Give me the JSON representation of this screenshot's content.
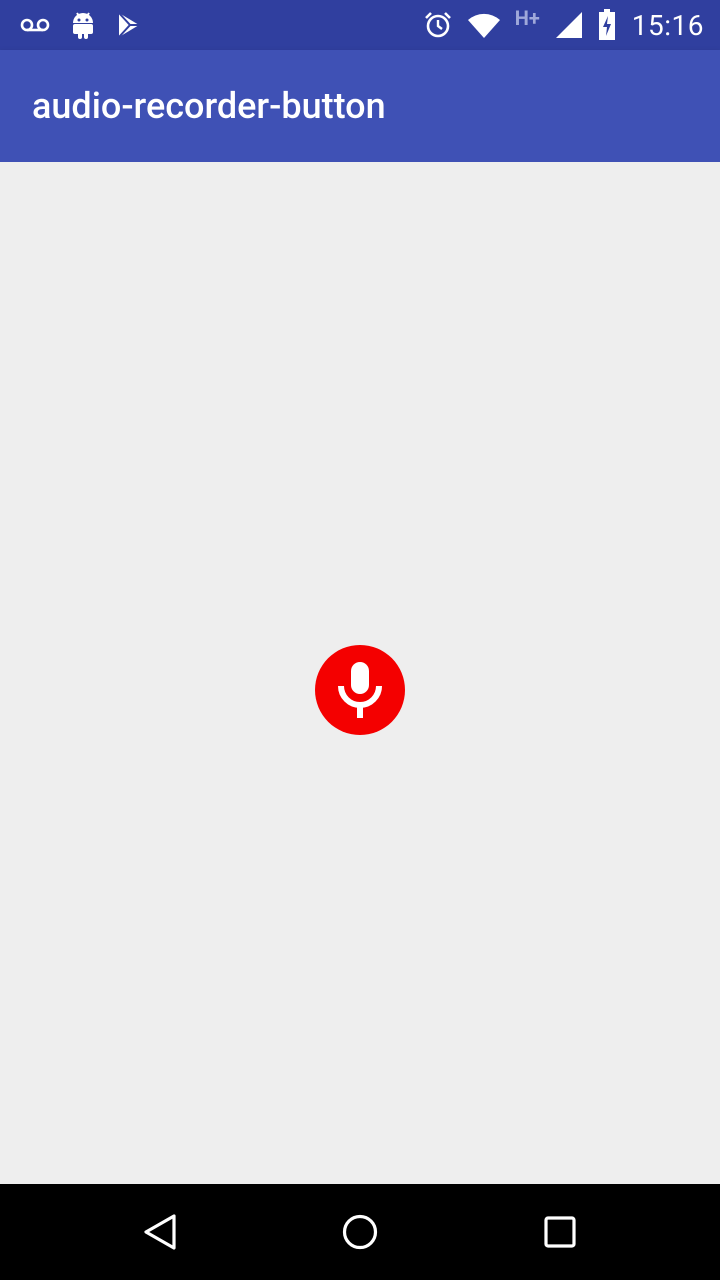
{
  "status_bar": {
    "left_icons": [
      "voicemail-icon",
      "android-icon",
      "play-store-icon"
    ],
    "right_icons": [
      "alarm-icon",
      "wifi-icon",
      "network-hplus-icon",
      "cell-signal-icon",
      "battery-charging-icon"
    ],
    "network_label": "H+",
    "time": "15:16",
    "background_color": "#303F9F"
  },
  "app_bar": {
    "title": "audio-recorder-button",
    "background_color": "#3F51B5"
  },
  "main": {
    "background_color": "#EEEEEE",
    "record_button": {
      "icon": "microphone-icon",
      "color": "#F40000"
    }
  },
  "nav_bar": {
    "buttons": [
      "back-icon",
      "home-icon",
      "recents-icon"
    ],
    "background_color": "#000000"
  }
}
